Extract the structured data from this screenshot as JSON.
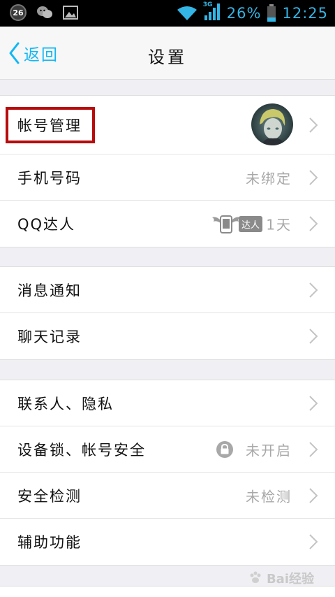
{
  "status_bar": {
    "notification_badge": "26",
    "network": "3G",
    "battery": "26%",
    "time": "12:25"
  },
  "nav": {
    "back_label": "返回",
    "title": "设置"
  },
  "groups": [
    {
      "rows": [
        {
          "label": "帐号管理"
        },
        {
          "label": "手机号码",
          "value": "未绑定"
        },
        {
          "label": "QQ达人",
          "badge": "达人",
          "value": "1天"
        }
      ]
    },
    {
      "rows": [
        {
          "label": "消息通知"
        },
        {
          "label": "聊天记录"
        }
      ]
    },
    {
      "rows": [
        {
          "label": "联系人、隐私"
        },
        {
          "label": "设备锁、帐号安全",
          "value": "未开启"
        },
        {
          "label": "安全检测",
          "value": "未检测"
        },
        {
          "label": "辅助功能"
        }
      ]
    }
  ],
  "watermark": "Bai经验",
  "colors": {
    "accent": "#12b7f5",
    "highlight": "#b80c0c",
    "statusbar_text": "#33b5e5"
  }
}
